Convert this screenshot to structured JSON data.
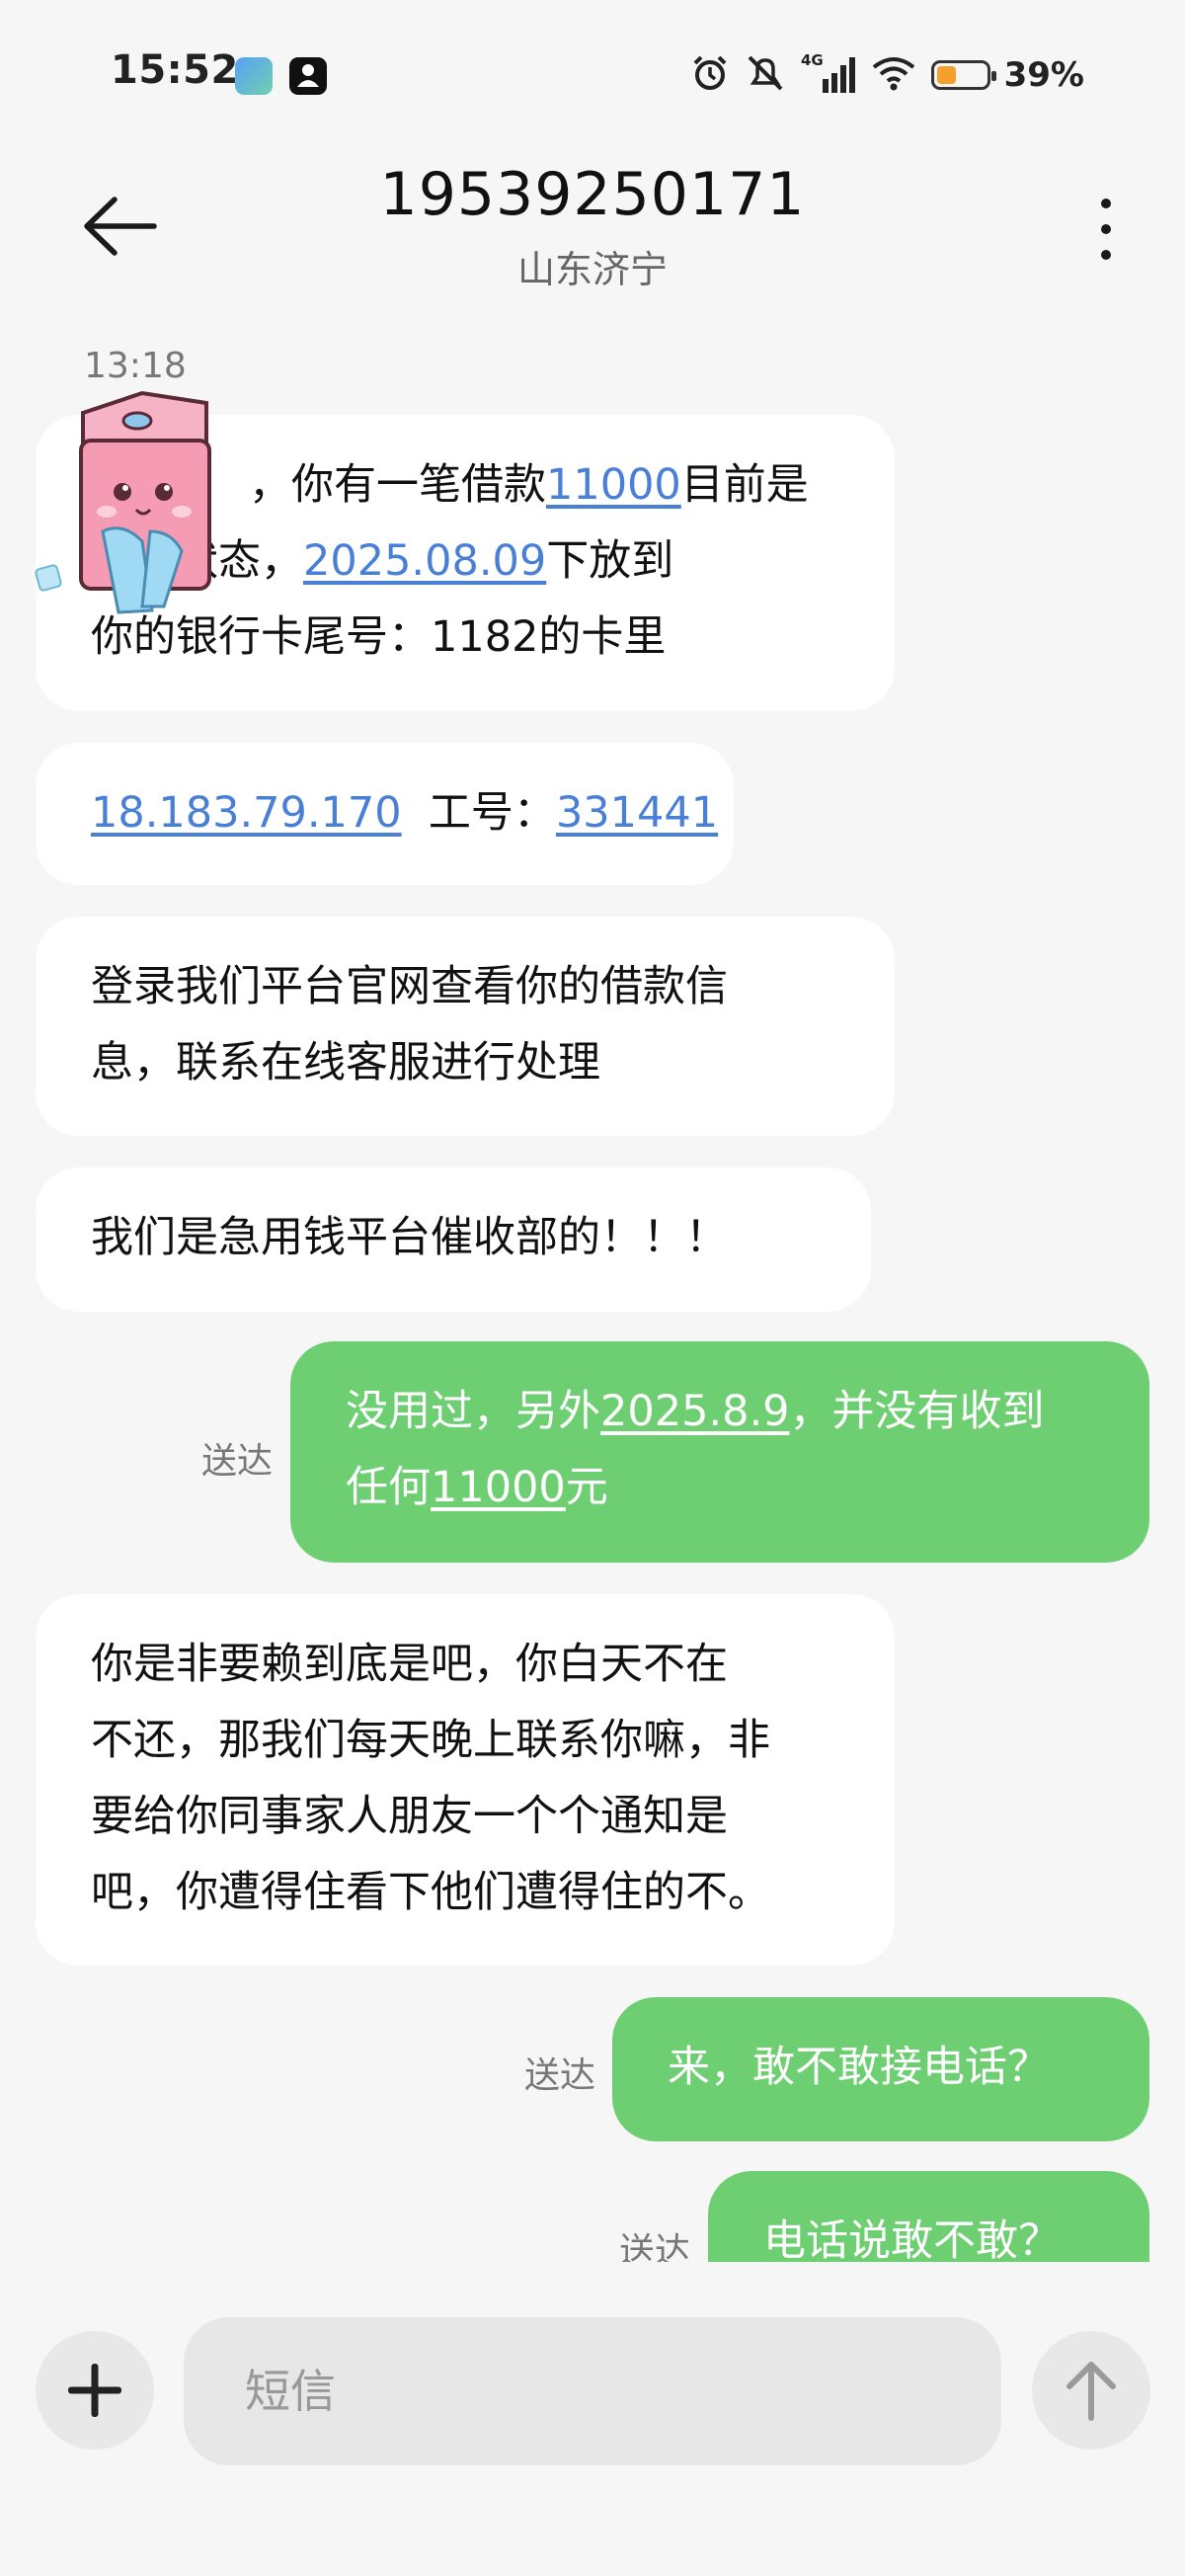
{
  "status_bar": {
    "time": "15:52",
    "network": "4G",
    "battery_percent": "39%",
    "battery_level": 0.39,
    "icons": [
      "gallery-app-icon",
      "id-app-icon",
      "alarm-icon",
      "mute-icon",
      "signal-icon",
      "wifi-icon",
      "battery-icon"
    ]
  },
  "header": {
    "title": "19539250171",
    "subtitle": "山东济宁",
    "back_icon": "back-arrow-icon",
    "more_icon": "more-vertical-icon"
  },
  "messages": {
    "timestamp": "13:18",
    "m1": {
      "l1a": "，你有一笔借款",
      "l1b": "11000",
      "l1c": "目前是",
      "l2a": "逾期状态，",
      "l2b": "2025.08.09",
      "l2c": "下放到",
      "l3": "你的银行卡尾号：1182的卡里"
    },
    "m2": {
      "a": "18.183.79.170",
      "b": "  工号：",
      "c": "331441"
    },
    "m3": {
      "l1": "登录我们平台官网查看你的借款信",
      "l2": "息，联系在线客服进行处理"
    },
    "m4": {
      "l1": "我们是急用钱平台催收部的！！！"
    },
    "m5": {
      "status": "送达",
      "l1a": "没用过，另外",
      "l1b": "2025.8.9",
      "l1c": "，并没有收到",
      "l2a": "任何",
      "l2b": "11000",
      "l2c": "元"
    },
    "m6": {
      "l1": "你是非要赖到底是吧，你白天不在",
      "l2": "不还，那我们每天晚上联系你嘛，非",
      "l3": "要给你同事家人朋友一个个通知是",
      "l4": "吧，你遭得住看下他们遭得住的不。"
    },
    "m7": {
      "status": "送达",
      "l1": "来，敢不敢接电话？"
    },
    "m8": {
      "status": "送达",
      "l1": "电话说敢不敢？"
    }
  },
  "composer": {
    "placeholder": "短信",
    "add_icon": "plus-icon",
    "send_icon": "send-arrow-icon"
  },
  "colors": {
    "incoming": "#ffffff",
    "outgoing": "#6ecf72",
    "link": "#4a7fd6",
    "background": "#f6f6f6"
  }
}
